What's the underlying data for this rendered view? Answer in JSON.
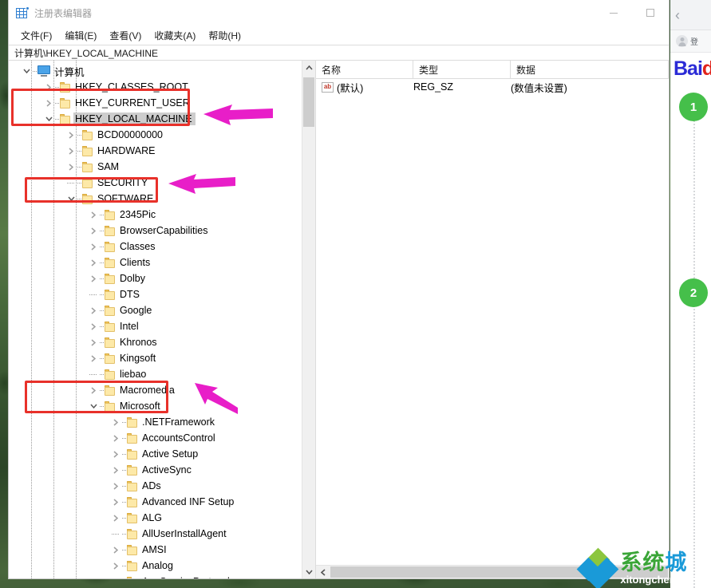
{
  "window": {
    "title": "注册表编辑器",
    "icon": "registry-icon",
    "minimize_label": "最小化",
    "maximize_label": "最大化"
  },
  "menubar": {
    "items": [
      {
        "label": "文件(F)",
        "name": "menu-file"
      },
      {
        "label": "编辑(E)",
        "name": "menu-edit"
      },
      {
        "label": "查看(V)",
        "name": "menu-view"
      },
      {
        "label": "收藏夹(A)",
        "name": "menu-favorites"
      },
      {
        "label": "帮助(H)",
        "name": "menu-help"
      }
    ]
  },
  "addressbar": {
    "path": "计算机\\HKEY_LOCAL_MACHINE"
  },
  "tree": {
    "nodes": [
      {
        "label": "计算机",
        "depth": 0,
        "twisty": "expanded",
        "icon": "computer",
        "selected": false
      },
      {
        "label": "HKEY_CLASSES_ROOT",
        "depth": 1,
        "twisty": "collapsed",
        "icon": "folder",
        "selected": false
      },
      {
        "label": "HKEY_CURRENT_USER",
        "depth": 1,
        "twisty": "collapsed",
        "icon": "folder",
        "selected": false
      },
      {
        "label": "HKEY_LOCAL_MACHINE",
        "depth": 1,
        "twisty": "expanded",
        "icon": "folder",
        "selected": true
      },
      {
        "label": "BCD00000000",
        "depth": 2,
        "twisty": "collapsed",
        "icon": "folder",
        "selected": false
      },
      {
        "label": "HARDWARE",
        "depth": 2,
        "twisty": "collapsed",
        "icon": "folder",
        "selected": false
      },
      {
        "label": "SAM",
        "depth": 2,
        "twisty": "collapsed",
        "icon": "folder",
        "selected": false
      },
      {
        "label": "SECURITY",
        "depth": 2,
        "twisty": "none",
        "icon": "folder",
        "selected": false
      },
      {
        "label": "SOFTWARE",
        "depth": 2,
        "twisty": "expanded",
        "icon": "folder",
        "selected": false
      },
      {
        "label": "2345Pic",
        "depth": 3,
        "twisty": "collapsed",
        "icon": "folder",
        "selected": false
      },
      {
        "label": "BrowserCapabilities",
        "depth": 3,
        "twisty": "collapsed",
        "icon": "folder",
        "selected": false
      },
      {
        "label": "Classes",
        "depth": 3,
        "twisty": "collapsed",
        "icon": "folder",
        "selected": false
      },
      {
        "label": "Clients",
        "depth": 3,
        "twisty": "collapsed",
        "icon": "folder",
        "selected": false
      },
      {
        "label": "Dolby",
        "depth": 3,
        "twisty": "collapsed",
        "icon": "folder",
        "selected": false
      },
      {
        "label": "DTS",
        "depth": 3,
        "twisty": "none",
        "icon": "folder",
        "selected": false
      },
      {
        "label": "Google",
        "depth": 3,
        "twisty": "collapsed",
        "icon": "folder",
        "selected": false
      },
      {
        "label": "Intel",
        "depth": 3,
        "twisty": "collapsed",
        "icon": "folder",
        "selected": false
      },
      {
        "label": "Khronos",
        "depth": 3,
        "twisty": "collapsed",
        "icon": "folder",
        "selected": false
      },
      {
        "label": "Kingsoft",
        "depth": 3,
        "twisty": "collapsed",
        "icon": "folder",
        "selected": false
      },
      {
        "label": "liebao",
        "depth": 3,
        "twisty": "none",
        "icon": "folder",
        "selected": false
      },
      {
        "label": "Macromedia",
        "depth": 3,
        "twisty": "collapsed",
        "icon": "folder",
        "selected": false
      },
      {
        "label": "Microsoft",
        "depth": 3,
        "twisty": "expanded",
        "icon": "folder",
        "selected": false
      },
      {
        "label": ".NETFramework",
        "depth": 4,
        "twisty": "collapsed",
        "icon": "folder",
        "selected": false
      },
      {
        "label": "AccountsControl",
        "depth": 4,
        "twisty": "collapsed",
        "icon": "folder",
        "selected": false
      },
      {
        "label": "Active Setup",
        "depth": 4,
        "twisty": "collapsed",
        "icon": "folder",
        "selected": false
      },
      {
        "label": "ActiveSync",
        "depth": 4,
        "twisty": "collapsed",
        "icon": "folder",
        "selected": false
      },
      {
        "label": "ADs",
        "depth": 4,
        "twisty": "collapsed",
        "icon": "folder",
        "selected": false
      },
      {
        "label": "Advanced INF Setup",
        "depth": 4,
        "twisty": "collapsed",
        "icon": "folder",
        "selected": false
      },
      {
        "label": "ALG",
        "depth": 4,
        "twisty": "collapsed",
        "icon": "folder",
        "selected": false
      },
      {
        "label": "AllUserInstallAgent",
        "depth": 4,
        "twisty": "none",
        "icon": "folder",
        "selected": false
      },
      {
        "label": "AMSI",
        "depth": 4,
        "twisty": "collapsed",
        "icon": "folder",
        "selected": false
      },
      {
        "label": "Analog",
        "depth": 4,
        "twisty": "collapsed",
        "icon": "folder",
        "selected": false
      },
      {
        "label": "AppServiceProtocols",
        "depth": 4,
        "twisty": "collapsed",
        "icon": "folder",
        "selected": false
      }
    ]
  },
  "values": {
    "columns": [
      "名称",
      "类型",
      "数据"
    ],
    "rows": [
      {
        "name": "(默认)",
        "type": "REG_SZ",
        "data": "(数值未设置)",
        "icon": "ab-string-icon"
      }
    ]
  },
  "annotations": {
    "boxes": [
      {
        "name": "highlight-hkey-local-machine",
        "color": "#e8312a"
      },
      {
        "name": "highlight-software",
        "color": "#e8312a"
      },
      {
        "name": "highlight-microsoft",
        "color": "#e8312a"
      }
    ],
    "arrows": [
      {
        "name": "arrow-to-hkey-local-machine",
        "color": "#e81ec8"
      },
      {
        "name": "arrow-to-software",
        "color": "#e81ec8"
      },
      {
        "name": "arrow-to-microsoft",
        "color": "#e81ec8"
      }
    ]
  },
  "browser_rail": {
    "back_label": "‹",
    "login_label": "登",
    "logo_bai": "Bai",
    "logo_du": "d",
    "steps": [
      {
        "number": "1"
      },
      {
        "number": "2"
      }
    ]
  },
  "watermark": {
    "cn_1": "系",
    "cn_2": "统",
    "cn_3": "城",
    "en": "xitongcheng.com"
  },
  "colors": {
    "annotation_box": "#e8312a",
    "annotation_arrow": "#e81ec8",
    "step_badge": "#45bf4a",
    "selection": "#cdcdcd",
    "folder": "#fde9a8"
  }
}
